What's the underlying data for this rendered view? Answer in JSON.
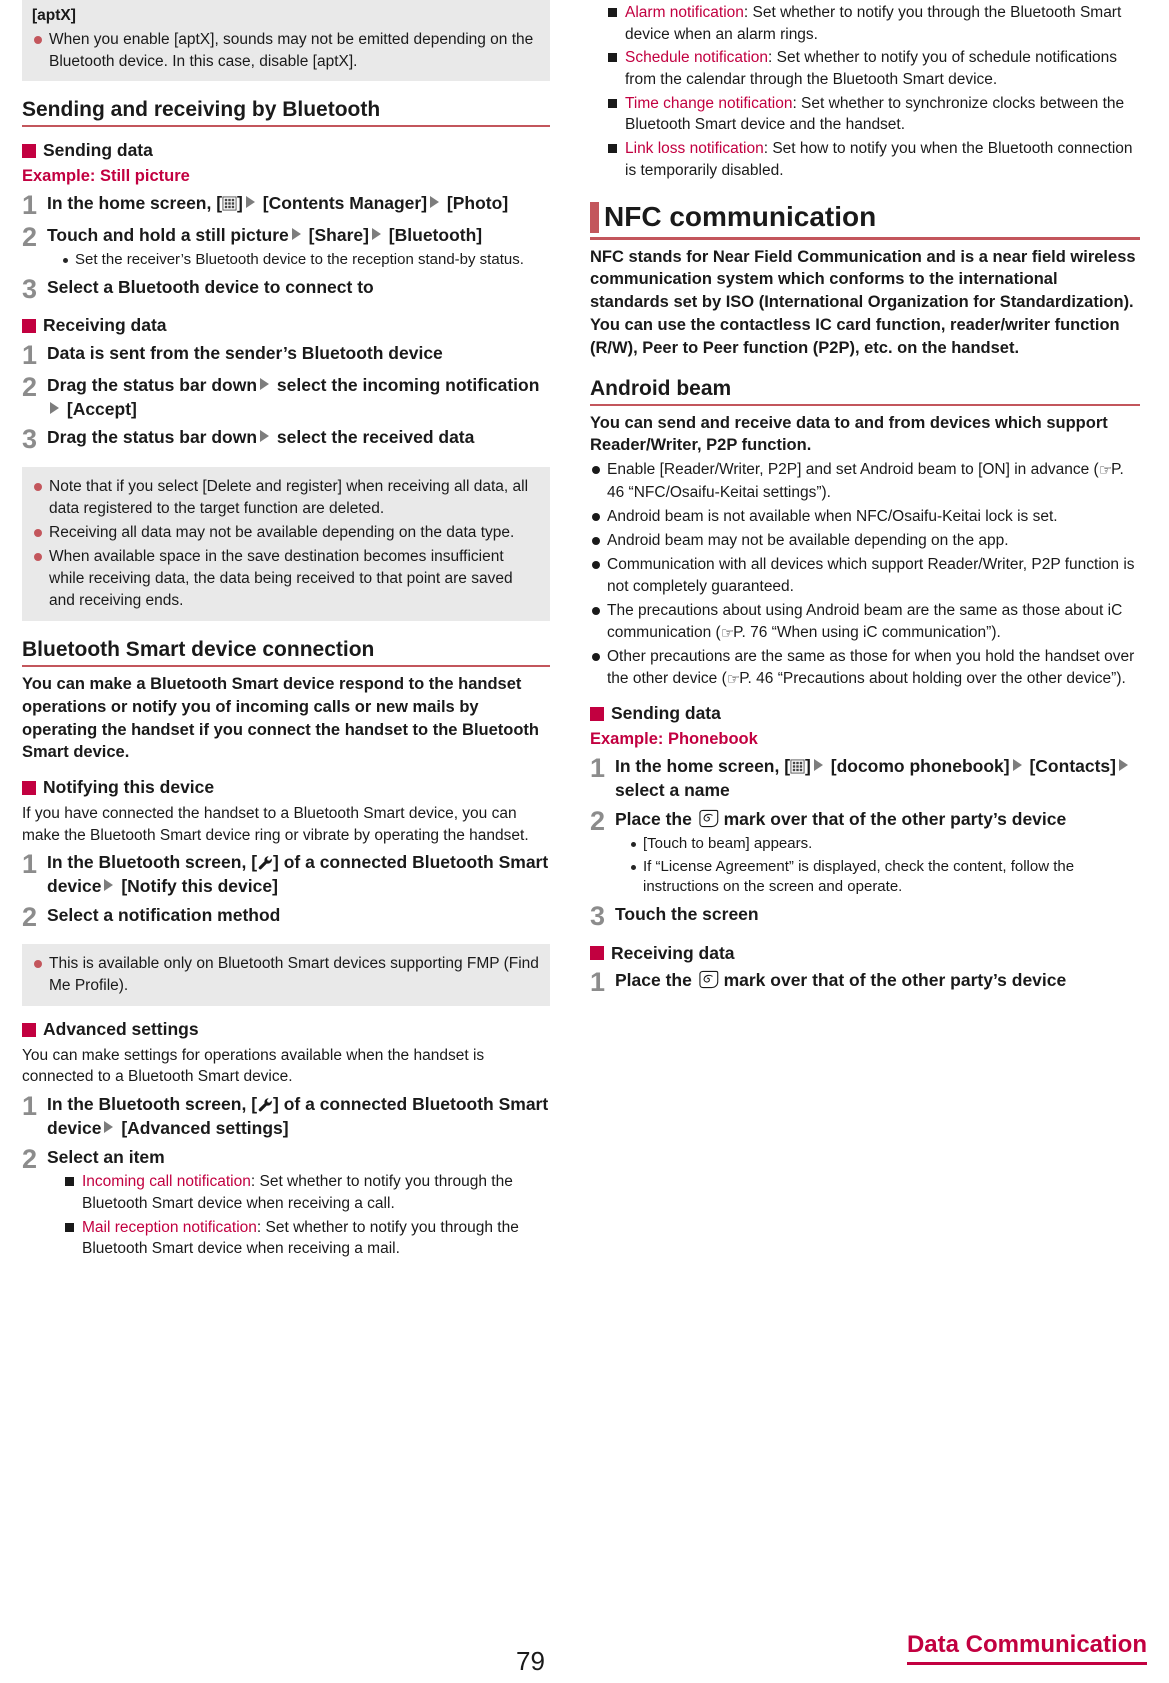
{
  "footer": {
    "page_number": "79",
    "chapter": "Data Communication"
  },
  "icons": {
    "apps": "apps-grid-icon",
    "wrench": "wrench-icon",
    "nfc_mark": "nfc-mark-icon",
    "reference": "pointing-hand-icon"
  },
  "colors": {
    "accent_rule": "#c3565c",
    "crimson": "#c20040",
    "note_bg": "#e9e9e9",
    "step_number": "#8c8c8c"
  },
  "left": {
    "aptx_note": {
      "title": "[aptX]",
      "items": [
        "When you enable [aptX], sounds may not be emitted depending on the Bluetooth device. In this case, disable [aptX]."
      ]
    },
    "h2_sending_receiving": "Sending and receiving by Bluetooth",
    "h3_sending_data": "Sending data",
    "example_still_picture": "Example: Still picture",
    "send_steps": [
      {
        "num": "1",
        "pre": "In the home screen, [",
        "post": "]",
        "after": " [Contents Manager]",
        "tail": " [Photo]"
      },
      {
        "num": "2",
        "text": "Touch and hold a still picture",
        "mid": " [Share]",
        "tail": " [Bluetooth]",
        "subs": [
          "Set the receiver’s Bluetooth device to the reception stand-by status."
        ]
      },
      {
        "num": "3",
        "text": "Select a Bluetooth device to connect to"
      }
    ],
    "h3_receiving_data": "Receiving data",
    "receive_steps": [
      {
        "num": "1",
        "text": "Data is sent from the sender’s Bluetooth device"
      },
      {
        "num": "2",
        "text": "Drag the status bar down",
        "mid": " select the incoming notification",
        "tail": " [Accept]"
      },
      {
        "num": "3",
        "text": "Drag the status bar down",
        "mid": " select the received data"
      }
    ],
    "receive_note": {
      "items": [
        "Note that if you select [Delete and register] when receiving all data, all data registered to the target function are deleted.",
        "Receiving all data may not be available depending on the data type.",
        "When available space in the save destination becomes insufficient while receiving data, the data being received to that point are saved and receiving ends."
      ]
    },
    "h2_bt_smart": "Bluetooth Smart device connection",
    "bt_smart_lead": "You can make a Bluetooth Smart device respond to the handset operations or notify you of incoming calls or new mails by operating the handset if you connect the handset to the Bluetooth Smart device.",
    "h3_notifying": "Notifying this device",
    "notifying_body": "If you have connected the handset to a Bluetooth Smart device, you can make the Bluetooth Smart device ring or vibrate by operating the handset.",
    "notify_steps": [
      {
        "num": "1",
        "pre": "In the Bluetooth screen, [",
        "post": "] of a connected Bluetooth Smart device",
        "tail": " [Notify this device]"
      },
      {
        "num": "2",
        "text": "Select a notification method"
      }
    ],
    "notify_note": {
      "items": [
        "This is available only on Bluetooth Smart devices supporting FMP (Find Me Profile)."
      ]
    },
    "h3_advanced": "Advanced settings",
    "advanced_body": "You can make settings for operations available when the handset is connected to a Bluetooth Smart device.",
    "advanced_steps": [
      {
        "num": "1",
        "pre": "In the Bluetooth screen, [",
        "post": "] of a connected Bluetooth Smart device",
        "tail": " [Advanced settings]"
      },
      {
        "num": "2",
        "text": "Select an item"
      }
    ],
    "advanced_items": [
      {
        "key": "Incoming call notification",
        "desc": ": Set whether to notify you through the Bluetooth Smart device when receiving a call."
      },
      {
        "key": "Mail reception notification",
        "desc": ": Set whether to notify you through the Bluetooth Smart device when receiving a mail."
      }
    ]
  },
  "right": {
    "advanced_items_cont": [
      {
        "key": "Alarm notification",
        "desc": ": Set whether to notify you through the Bluetooth Smart device when an alarm rings."
      },
      {
        "key": "Schedule notification",
        "desc": ": Set whether to notify you of schedule notifications from the calendar through the Bluetooth Smart device."
      },
      {
        "key": "Time change notification",
        "desc": ": Set whether to synchronize clocks between the Bluetooth Smart device and the handset."
      },
      {
        "key": "Link loss notification",
        "desc": ": Set how to notify you when the Bluetooth connection is temporarily disabled."
      }
    ],
    "h1_nfc": "NFC communication",
    "nfc_lead": "NFC stands for Near Field Communication and is a near field wireless communication system which conforms to the international standards set by ISO (International Organization for Standardization). You can use the contactless IC card function, reader/writer function (R/W), Peer to Peer function (P2P), etc. on the handset.",
    "h2_android_beam": "Android beam",
    "beam_lead": "You can send and receive data to and from devices which support Reader/Writer, P2P function.",
    "beam_bullets": [
      {
        "pre": "Enable [Reader/Writer, P2P] and set Android beam to [ON] in advance (",
        "ref": "P. 46 “NFC/Osaifu-Keitai settings”).",
        "post": ""
      },
      {
        "pre": "Android beam is not available when NFC/Osaifu-Keitai lock is set.",
        "ref": "",
        "post": ""
      },
      {
        "pre": "Android beam may not be available depending on the app.",
        "ref": "",
        "post": ""
      },
      {
        "pre": "Communication with all devices which support Reader/Writer, P2P function is not completely guaranteed.",
        "ref": "",
        "post": ""
      },
      {
        "pre": "The precautions about using Android beam are the same as those about iC communication (",
        "ref": "P. 76 “When using iC communication”).",
        "post": ""
      },
      {
        "pre": "Other precautions are the same as those for when you hold the handset over the other device (",
        "ref": "P. 46 “Precautions about holding over the other device”).",
        "post": ""
      }
    ],
    "h3_sending_data": "Sending data",
    "example_phonebook": "Example: Phonebook",
    "send_steps": [
      {
        "num": "1",
        "pre": "In the home screen, [",
        "post": "]",
        "after": " [docomo phonebook]",
        "mid": " [Contacts]",
        "tail": " select a name"
      },
      {
        "num": "2",
        "pre": "Place the ",
        "post": " mark over that of the other party’s device",
        "subs": [
          "[Touch to beam] appears.",
          "If “License Agreement” is displayed, check the content, follow the instructions on the screen and operate."
        ]
      },
      {
        "num": "3",
        "text": "Touch the screen"
      }
    ],
    "h3_receiving_data": "Receiving data",
    "receive_steps": [
      {
        "num": "1",
        "pre": "Place the ",
        "post": " mark over that of the other party’s device"
      }
    ]
  }
}
